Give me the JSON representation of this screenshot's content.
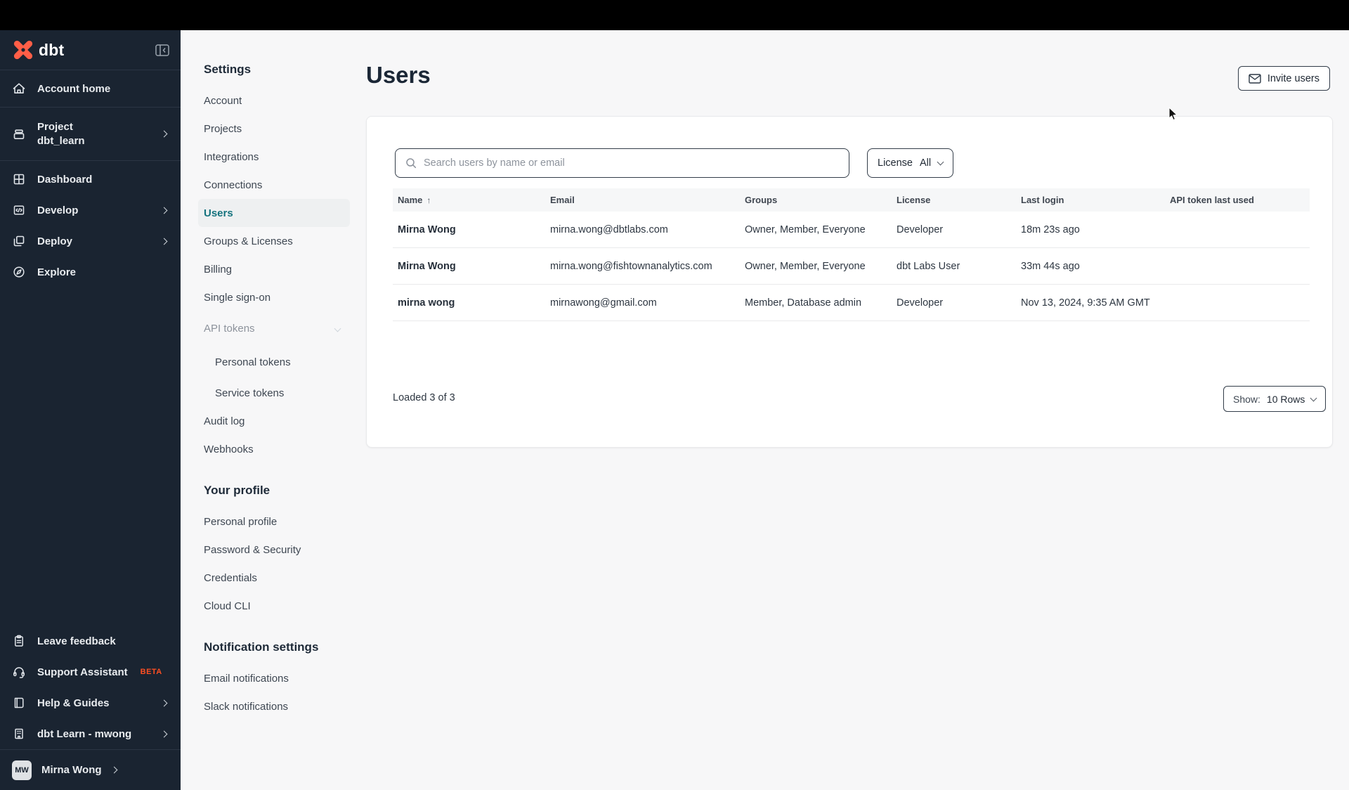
{
  "brand": {
    "logo_text": "dbt"
  },
  "sidebar": {
    "items": [
      {
        "label": "Account home"
      },
      {
        "label": "Project",
        "sublabel": "dbt_learn"
      },
      {
        "label": "Dashboard"
      },
      {
        "label": "Develop"
      },
      {
        "label": "Deploy"
      },
      {
        "label": "Explore"
      }
    ],
    "footer_items": [
      {
        "label": "Leave feedback"
      },
      {
        "label": "Support Assistant",
        "badge": "BETA"
      },
      {
        "label": "Help & Guides"
      },
      {
        "label": "dbt Learn - mwong"
      }
    ],
    "user": {
      "initials": "MW",
      "name": "Mirna Wong"
    }
  },
  "settings_nav": {
    "heading": "Settings",
    "items": [
      "Account",
      "Projects",
      "Integrations",
      "Connections",
      "Users",
      "Groups & Licenses",
      "Billing",
      "Single sign-on"
    ],
    "active_item": "Users",
    "api_tokens_group": {
      "label": "API tokens",
      "children": [
        "Personal tokens",
        "Service tokens"
      ]
    },
    "items_after": [
      "Audit log",
      "Webhooks"
    ],
    "profile_heading": "Your profile",
    "profile_items": [
      "Personal profile",
      "Password & Security",
      "Credentials",
      "Cloud CLI"
    ],
    "notifications_heading": "Notification settings",
    "notification_items": [
      "Email notifications",
      "Slack notifications"
    ]
  },
  "main": {
    "title": "Users",
    "invite_button_label": "Invite users",
    "search_placeholder": "Search users by name or email",
    "license_filter": {
      "label": "License",
      "value": "All"
    },
    "table": {
      "columns": [
        "Name",
        "Email",
        "Groups",
        "License",
        "Last login",
        "API token last used"
      ],
      "sort_column": "Name",
      "sort_direction": "ascending",
      "rows": [
        {
          "name": "Mirna Wong",
          "email": "mirna.wong@dbtlabs.com",
          "groups": "Owner, Member, Everyone",
          "license": "Developer",
          "last_login": "18m 23s ago",
          "api_token_last_used": ""
        },
        {
          "name": "Mirna Wong",
          "email": "mirna.wong@fishtownanalytics.com",
          "groups": "Owner, Member, Everyone",
          "license": "dbt Labs User",
          "last_login": "33m 44s ago",
          "api_token_last_used": ""
        },
        {
          "name": "mirna wong",
          "email": "mirnawong@gmail.com",
          "groups": "Member, Database admin",
          "license": "Developer",
          "last_login": "Nov 13, 2024, 9:35 AM GMT",
          "api_token_last_used": ""
        }
      ]
    },
    "footer": {
      "loaded_text": "Loaded 3 of 3",
      "show_label": "Show:",
      "show_value": "10 Rows"
    }
  },
  "colors": {
    "accent_teal": "#15737e",
    "brand_orange": "#ff5e47",
    "beta_badge": "#ff4f22",
    "sidebar_bg": "#1a2431",
    "page_bg": "#f7f7f8",
    "dark_border": "#333d49"
  }
}
